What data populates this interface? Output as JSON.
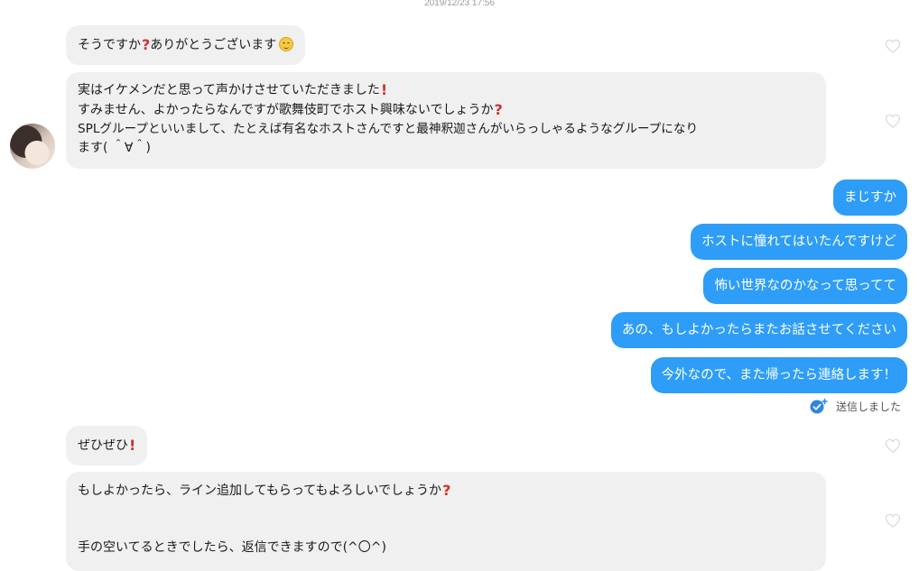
{
  "timestamp": "2019/12/23 17:56",
  "incoming": {
    "msg1": {
      "text": "そうですか",
      "text2": "ありがとうございます"
    },
    "msg2": {
      "line1": "実はイケメンだと思って声かけさせていただきました",
      "line2": "すみません、よかったらなんですが歌舞伎町でホスト興味ないでしょうか",
      "line3": "SPLグループといいまして、たとえば有名なホストさんですと最神釈迦さんがいらっしゃるようなグループになり",
      "line4": "ます( ＾∀＾)"
    },
    "msg3": {
      "text": "ぜひぜひ"
    },
    "msg4": {
      "line1": "もしよかったら、ライン追加してもらってもよろしいでしょうか",
      "line2": "手の空いてるときでしたら、返信できますので(^〇^)"
    }
  },
  "outgoing": [
    {
      "text": "まじすか"
    },
    {
      "text": "ホストに憧れてはいたんですけど"
    },
    {
      "text": "怖い世界なのかなって思ってて"
    },
    {
      "text": "あの、もしよかったらまたお話させてください"
    },
    {
      "text": "今外なので、また帰ったら連絡します！"
    }
  ],
  "status": {
    "sent_label": "送信しました"
  },
  "icons": {
    "like": "heart-outline-icon",
    "sent": "sent-check-icon",
    "question_mark": "?",
    "exclamation_mark": "!",
    "smile": "smiling-face-icon"
  },
  "colors": {
    "outgoing_bubble": "#2e9df7",
    "incoming_bubble": "#f0f0f0",
    "emoji_red": "#d0312d"
  }
}
